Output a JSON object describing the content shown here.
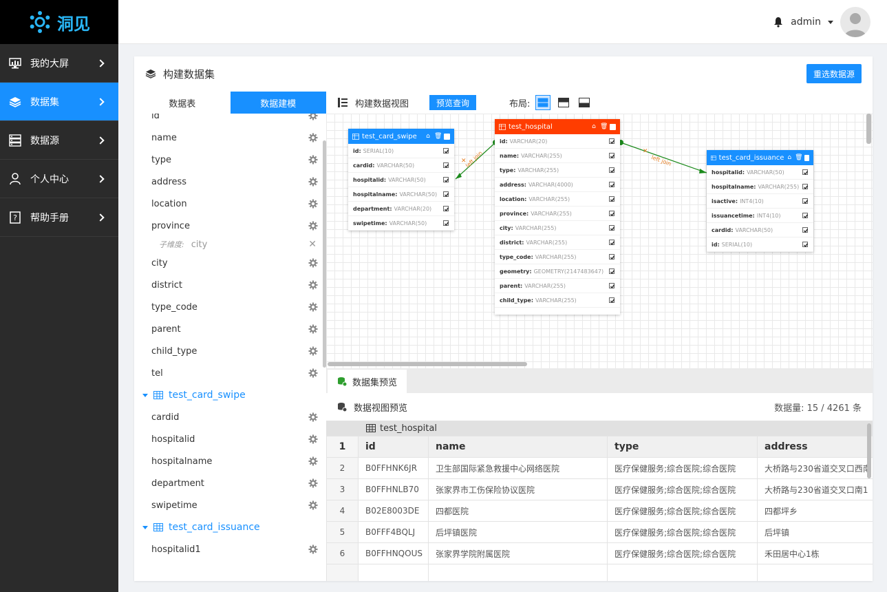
{
  "brand": {
    "logo_text": "洞见"
  },
  "sidebar": {
    "items": [
      {
        "label": "我的大屏",
        "icon": "monitor-icon",
        "active": false
      },
      {
        "label": "数据集",
        "icon": "layers-icon",
        "active": true
      },
      {
        "label": "数据源",
        "icon": "server-icon",
        "active": false
      },
      {
        "label": "个人中心",
        "icon": "user-icon",
        "active": false
      },
      {
        "label": "帮助手册",
        "icon": "help-book-icon",
        "active": false
      }
    ]
  },
  "header": {
    "username": "admin"
  },
  "page": {
    "title": "构建数据集",
    "reselect_label": "重选数据源",
    "tabs": [
      {
        "label": "数据表",
        "active": false
      },
      {
        "label": "数据建模",
        "active": true
      }
    ]
  },
  "fields": {
    "hospital": [
      "id",
      "name",
      "type",
      "address",
      "location",
      "province"
    ],
    "subdim": {
      "label": "子维度:",
      "value": "city"
    },
    "hospital_rest": [
      "city",
      "district",
      "type_code",
      "parent",
      "child_type",
      "tel"
    ],
    "group_swipe": "test_card_swipe",
    "swipe": [
      "cardid",
      "hospitalid",
      "hospitalname",
      "department",
      "swipetime"
    ],
    "group_issuance": "test_card_issuance",
    "issuance": [
      "hospitalid1"
    ]
  },
  "toolbar": {
    "title": "构建数据视图",
    "preview_label": "预览查询",
    "layout_label": "布局:"
  },
  "tables": {
    "swipe": {
      "name": "test_card_swipe",
      "rows": [
        [
          "id:",
          "SERIAL(10)"
        ],
        [
          "cardid:",
          "VARCHAR(50)"
        ],
        [
          "hospitalid:",
          "VARCHAR(50)"
        ],
        [
          "hospitalname:",
          "VARCHAR(50)"
        ],
        [
          "department:",
          "VARCHAR(20)"
        ],
        [
          "swipetime:",
          "VARCHAR(50)"
        ]
      ]
    },
    "hospital": {
      "name": "test_hospital",
      "rows": [
        [
          "id:",
          "VARCHAR(20)"
        ],
        [
          "name:",
          "VARCHAR(255)"
        ],
        [
          "type:",
          "VARCHAR(255)"
        ],
        [
          "address:",
          "VARCHAR(4000)"
        ],
        [
          "location:",
          "VARCHAR(255)"
        ],
        [
          "province:",
          "VARCHAR(255)"
        ],
        [
          "city:",
          "VARCHAR(255)"
        ],
        [
          "district:",
          "VARCHAR(255)"
        ],
        [
          "type_code:",
          "VARCHAR(255)"
        ],
        [
          "geometry:",
          "GEOMETRY(2147483647)"
        ],
        [
          "parent:",
          "VARCHAR(255)"
        ],
        [
          "child_type:",
          "VARCHAR(255)"
        ]
      ]
    },
    "issuance": {
      "name": "test_card_issuance",
      "rows": [
        [
          "hospitalid:",
          "VARCHAR(50)"
        ],
        [
          "hospitalname:",
          "VARCHAR(255)"
        ],
        [
          "isactive:",
          "INT4(10)"
        ],
        [
          "issuancetime:",
          "INT4(10)"
        ],
        [
          "cardid:",
          "VARCHAR(50)"
        ],
        [
          "id:",
          "SERIAL(10)"
        ]
      ]
    },
    "relation_label": "left join"
  },
  "preview": {
    "tab_label": "数据集预览",
    "heading": "数据视图预览",
    "count_label": "数据量:",
    "count_value": "15 / 4261 条",
    "table_name": "test_hospital",
    "columns": [
      "id",
      "name",
      "type",
      "address"
    ],
    "rows": [
      [
        "B0FFHNK6JR",
        "卫生部国际紧急救援中心网络医院",
        "医疗保健服务;综合医院;综合医院",
        "大桥路与230省道交叉口西南"
      ],
      [
        "B0FFHNLB70",
        "张家界市工伤保险协议医院",
        "医疗保健服务;综合医院;综合医院",
        "大桥路与230省道交叉口南1"
      ],
      [
        "B02E8003DE",
        "四都医院",
        "医疗保健服务;综合医院;综合医院",
        "四都坪乡"
      ],
      [
        "B0FFF4BQLJ",
        "后坪镇医院",
        "医疗保健服务;综合医院;综合医院",
        "后坪镇"
      ],
      [
        "B0FFHNQOUS",
        "张家界学院附属医院",
        "医疗保健服务;综合医院;综合医院",
        "禾田居中心1栋"
      ]
    ]
  },
  "colors": {
    "primary": "#1890ff",
    "hospital_header": "#ff3d00",
    "sidebar_bg": "#2b2b2b",
    "join_line": "#1b8a1b"
  }
}
